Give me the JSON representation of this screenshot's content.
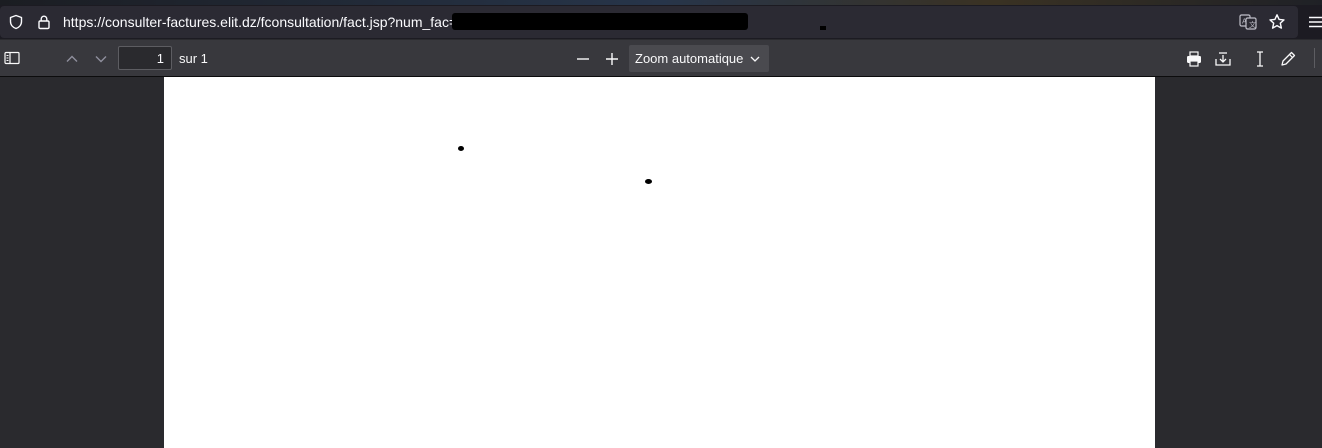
{
  "browser": {
    "url_text": "https://consulter-factures.elit.dz/fconsultation/fact.jsp?num_fac=",
    "icons": {
      "shield": "shield-icon",
      "lock": "lock-icon",
      "translate": "translate-icon",
      "bookmark": "star-icon",
      "menu": "menu-icon"
    }
  },
  "pdf_toolbar": {
    "page_number": "1",
    "page_count": "sur 1",
    "zoom_label": "Zoom automatique",
    "icons": {
      "sidebar": "sidebar-toggle-icon",
      "prev": "chevron-up-icon",
      "next": "chevron-down-icon",
      "zoom_out": "minus-icon",
      "zoom_in": "plus-icon",
      "print": "print-icon",
      "download": "download-icon",
      "text_select": "text-cursor-icon",
      "draw": "pen-icon"
    }
  },
  "colors": {
    "toolbar_bg": "#38383d",
    "viewer_bg": "#2a2a2e",
    "page_bg": "#ffffff",
    "urlbar_bg": "#2b2a33"
  }
}
